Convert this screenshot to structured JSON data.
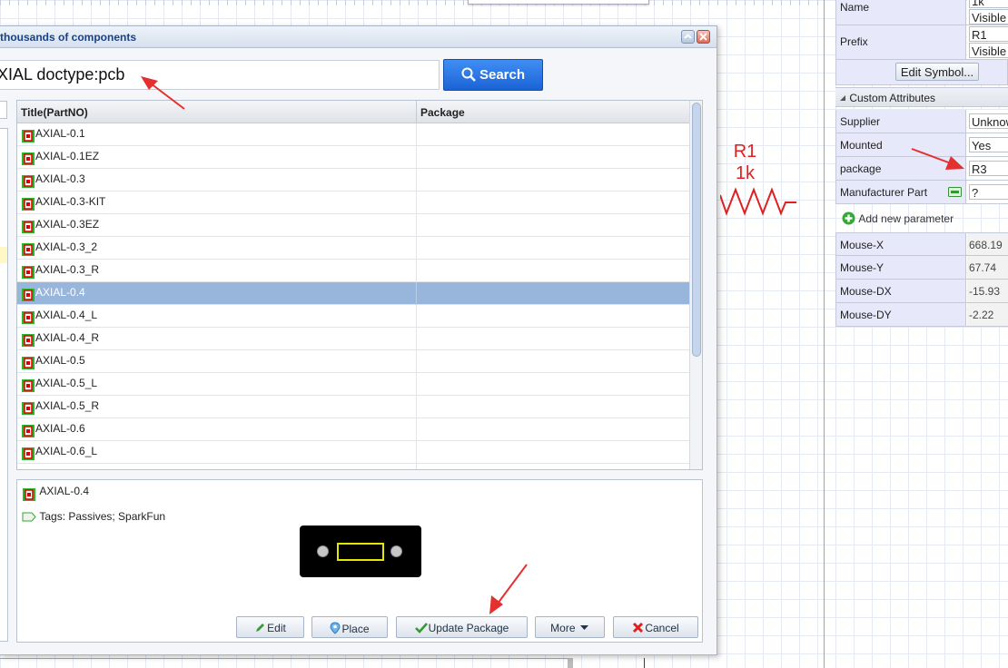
{
  "canvas": {
    "resistor": {
      "name": "R1",
      "value": "1k"
    }
  },
  "dialog": {
    "title": "thousands of components",
    "search": {
      "value": "XIAL doctype:pcb",
      "button_label": "Search"
    },
    "grid": {
      "columns": [
        "Title(PartNO)",
        "Package"
      ],
      "rows": [
        "AXIAL-0.1",
        "AXIAL-0.1EZ",
        "AXIAL-0.3",
        "AXIAL-0.3-KIT",
        "AXIAL-0.3EZ",
        "AXIAL-0.3_2",
        "AXIAL-0.3_R",
        "AXIAL-0.4",
        "AXIAL-0.4_L",
        "AXIAL-0.4_R",
        "AXIAL-0.5",
        "AXIAL-0.5_L",
        "AXIAL-0.5_R",
        "AXIAL-0.6",
        "AXIAL-0.6_L",
        ""
      ],
      "selected_index": 7
    },
    "details": {
      "title": "AXIAL-0.4",
      "tags": "Tags: Passives; SparkFun"
    },
    "actions": {
      "edit": "Edit",
      "place": "Place",
      "update_package": "Update Package",
      "more": "More",
      "cancel": "Cancel"
    }
  },
  "panel": {
    "name": {
      "label": "Name",
      "value": "1k",
      "visibility": "Visible"
    },
    "prefix": {
      "label": "Prefix",
      "value": "R1",
      "visibility": "Visible"
    },
    "edit_symbol": "Edit Symbol...",
    "custom_attributes": {
      "title": "Custom Attributes",
      "supplier": {
        "label": "Supplier",
        "value": "Unknown"
      },
      "mounted": {
        "label": "Mounted",
        "value": "Yes"
      },
      "package": {
        "label": "package",
        "value": "R3"
      },
      "manufacturer_part": {
        "label": "Manufacturer Part",
        "value": "?"
      }
    },
    "add_parameter": "Add new parameter",
    "mouse": [
      {
        "label": "Mouse-X",
        "value": "668.19"
      },
      {
        "label": "Mouse-Y",
        "value": "67.74"
      },
      {
        "label": "Mouse-DX",
        "value": "-15.93"
      },
      {
        "label": "Mouse-DY",
        "value": "-2.22"
      }
    ]
  },
  "colors": {
    "accent_blue": "#1b63d6",
    "selection": "#98b6dc",
    "annotation_red": "#e53030",
    "resistor_red": "#e02020"
  },
  "icons": {
    "search": "search-icon",
    "component": "chip-icon",
    "tag": "tag-icon",
    "edit": "pencil-icon",
    "place": "pin-icon",
    "update": "check-icon",
    "cancel": "x-icon",
    "add": "plus-icon"
  }
}
